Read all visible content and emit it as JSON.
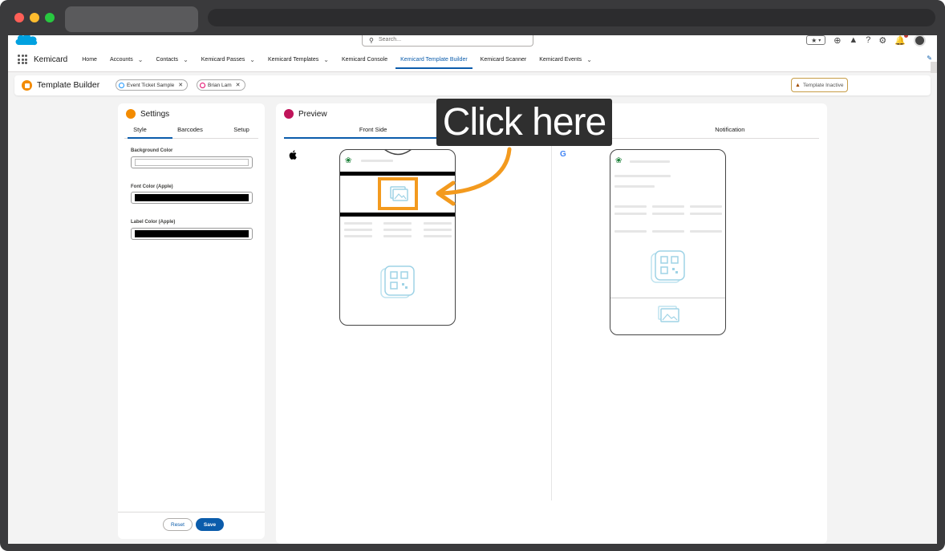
{
  "window": {
    "title": ""
  },
  "header": {
    "search_placeholder": "Search...",
    "app_name": "Kemicard",
    "nav_items": [
      {
        "label": "Home",
        "dropdown": false
      },
      {
        "label": "Accounts",
        "dropdown": true
      },
      {
        "label": "Contacts",
        "dropdown": true
      },
      {
        "label": "Kemicard Passes",
        "dropdown": true
      },
      {
        "label": "Kemicard Templates",
        "dropdown": true
      },
      {
        "label": "Kemicard Console",
        "dropdown": false
      },
      {
        "label": "Kemicard Template Builder",
        "dropdown": false,
        "active": true
      },
      {
        "label": "Kemicard Scanner",
        "dropdown": false
      },
      {
        "label": "Kemicard Events",
        "dropdown": true
      }
    ]
  },
  "page": {
    "title": "Template Builder",
    "pills": [
      {
        "label": "Event Ticket Sample",
        "color": "#1b96ff"
      },
      {
        "label": "Brian Lam",
        "color": "#e3066a"
      }
    ],
    "status_badge": "Template Inactive"
  },
  "settings": {
    "title": "Settings",
    "tabs": [
      "Style",
      "Barcodes",
      "Setup"
    ],
    "active_tab": "Style",
    "fields": [
      {
        "label": "Background Color",
        "value_color": "#ffffff"
      },
      {
        "label": "Font Color (Apple)",
        "value_color": "#000000"
      },
      {
        "label": "Label Color (Apple)",
        "value_color": "#000000"
      }
    ],
    "reset_label": "Reset",
    "save_label": "Save"
  },
  "preview": {
    "title": "Preview",
    "tabs": [
      "Front Side",
      "",
      "Notification"
    ],
    "active_tab": "Front Side",
    "platforms": [
      "apple-icon",
      "google-icon"
    ]
  },
  "overlay": {
    "callout_text": "Click here",
    "accent_color": "#f39a1e"
  }
}
